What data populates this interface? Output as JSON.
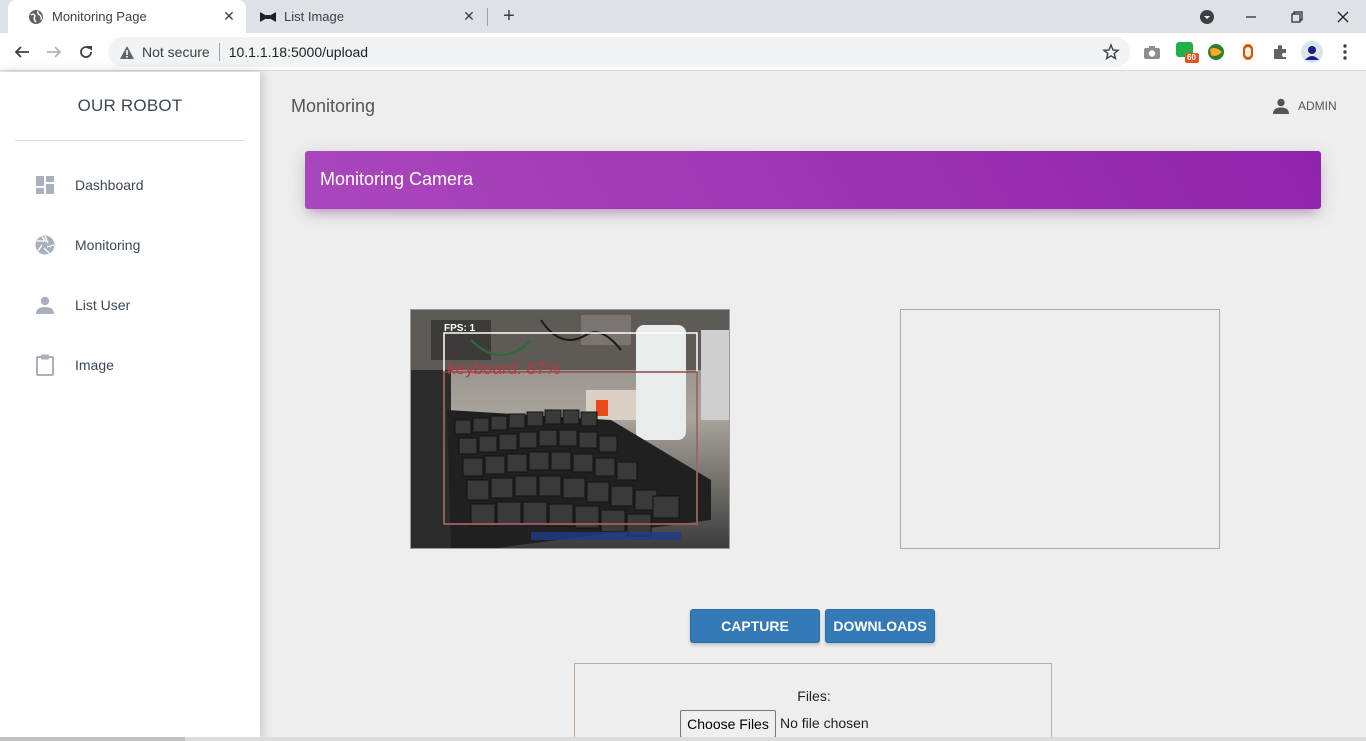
{
  "browser": {
    "tabs": [
      {
        "title": "Monitoring Page",
        "active": true
      },
      {
        "title": "List Image",
        "active": false
      }
    ],
    "address": {
      "security": "Not secure",
      "url": "10.1.1.18:5000/upload"
    },
    "extension_badge": "60"
  },
  "sidebar": {
    "brand": "OUR ROBOT",
    "items": [
      {
        "label": "Dashboard",
        "icon": "dashboard-icon"
      },
      {
        "label": "Monitoring",
        "icon": "camera-aperture-icon"
      },
      {
        "label": "List User",
        "icon": "person-icon"
      },
      {
        "label": "Image",
        "icon": "clipboard-icon"
      }
    ]
  },
  "topnav": {
    "title": "Monitoring",
    "user": "ADMIN"
  },
  "card": {
    "title": "Monitoring Camera"
  },
  "camera_overlay": {
    "fps": "FPS: 1",
    "detection": "keyboard: 87%"
  },
  "buttons": {
    "capture": "CAPTURE",
    "downloads": "DOWNLOADS"
  },
  "upload": {
    "label": "Files:",
    "button": "Choose Files",
    "status": "No file chosen"
  },
  "colors": {
    "accent": "#9c27b0",
    "button": "#337ab7"
  }
}
